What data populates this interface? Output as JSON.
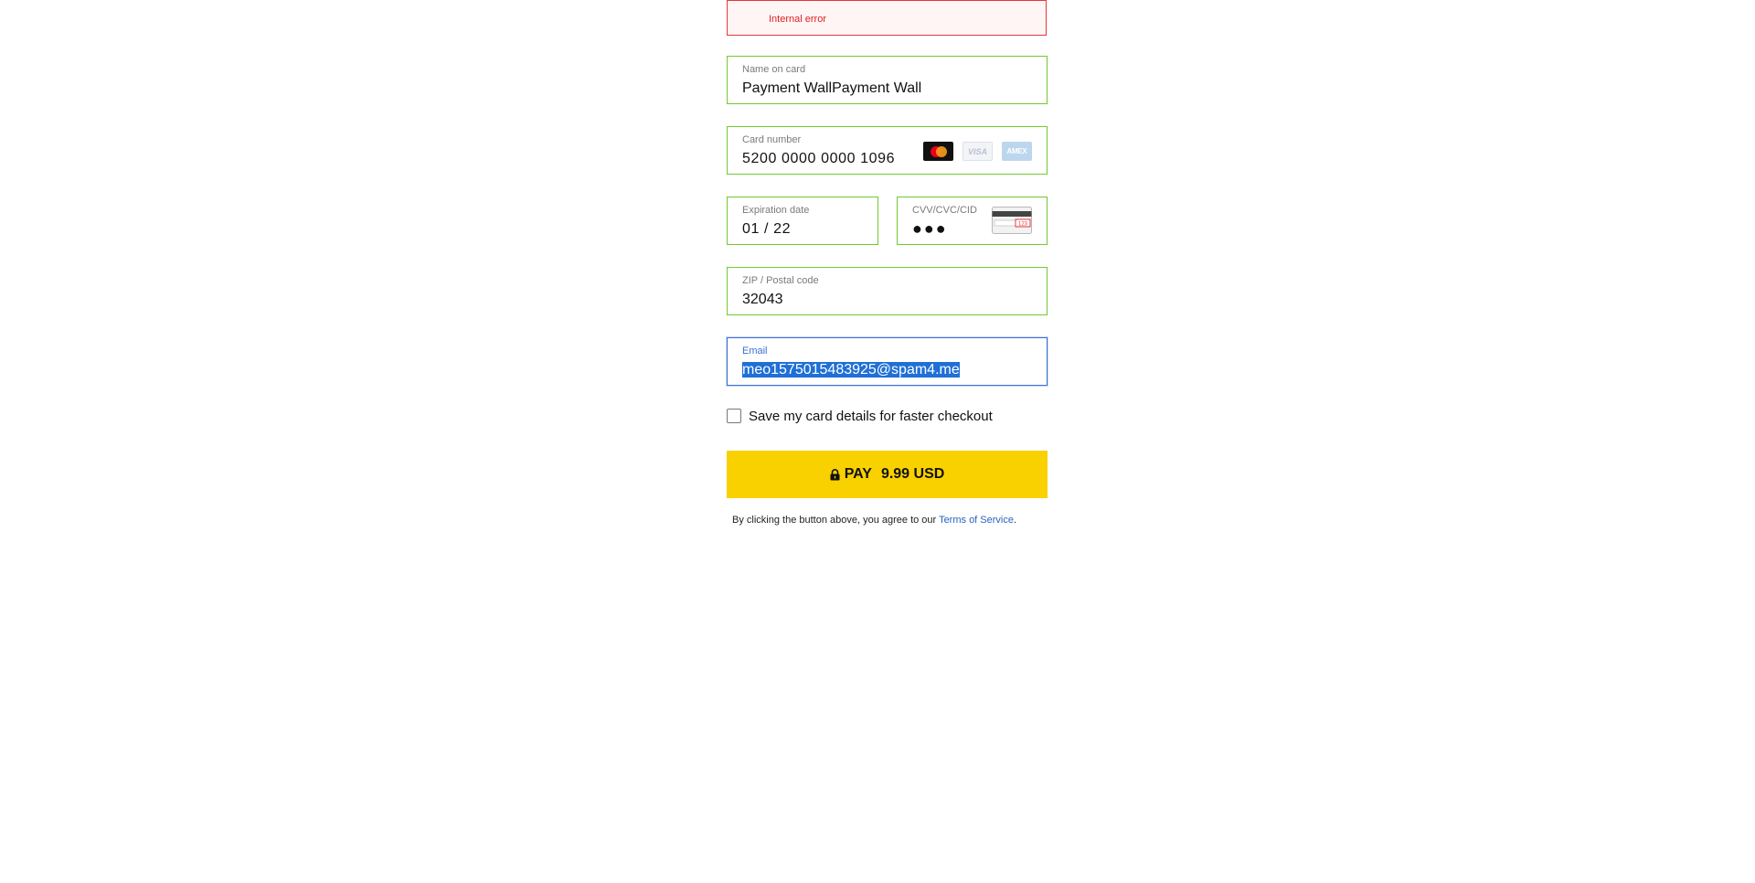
{
  "error": {
    "message": "Internal error"
  },
  "fields": {
    "name": {
      "label": "Name on card",
      "value": "Payment WallPayment Wall"
    },
    "card": {
      "label": "Card number",
      "value": "5200 0000 0000 1096",
      "brands": [
        "mastercard-icon",
        "visa-icon",
        "amex-icon"
      ],
      "visa_text": "VISA",
      "amex_text": "AMEX"
    },
    "expiry": {
      "label": "Expiration date",
      "value": "01 / 22"
    },
    "cvv": {
      "label": "CVV/CVC/CID",
      "value": "●●●",
      "icon_text": "123"
    },
    "zip": {
      "label": "ZIP / Postal code",
      "value": "32043"
    },
    "email": {
      "label": "Email",
      "value": "meo1575015483925@spam4.me"
    }
  },
  "save_card": {
    "label": "Save my card details for faster checkout",
    "checked": false
  },
  "pay_button": {
    "label": "PAY",
    "amount": "9.99 USD"
  },
  "terms": {
    "prefix": "By clicking the button above, you agree to our ",
    "link": "Terms of Service",
    "suffix": "."
  },
  "colors": {
    "valid_border": "#72c92f",
    "error_border": "#e8363c",
    "focus_border": "#3b6fd8",
    "pay_button": "#f9d100",
    "link": "#2762c4"
  }
}
